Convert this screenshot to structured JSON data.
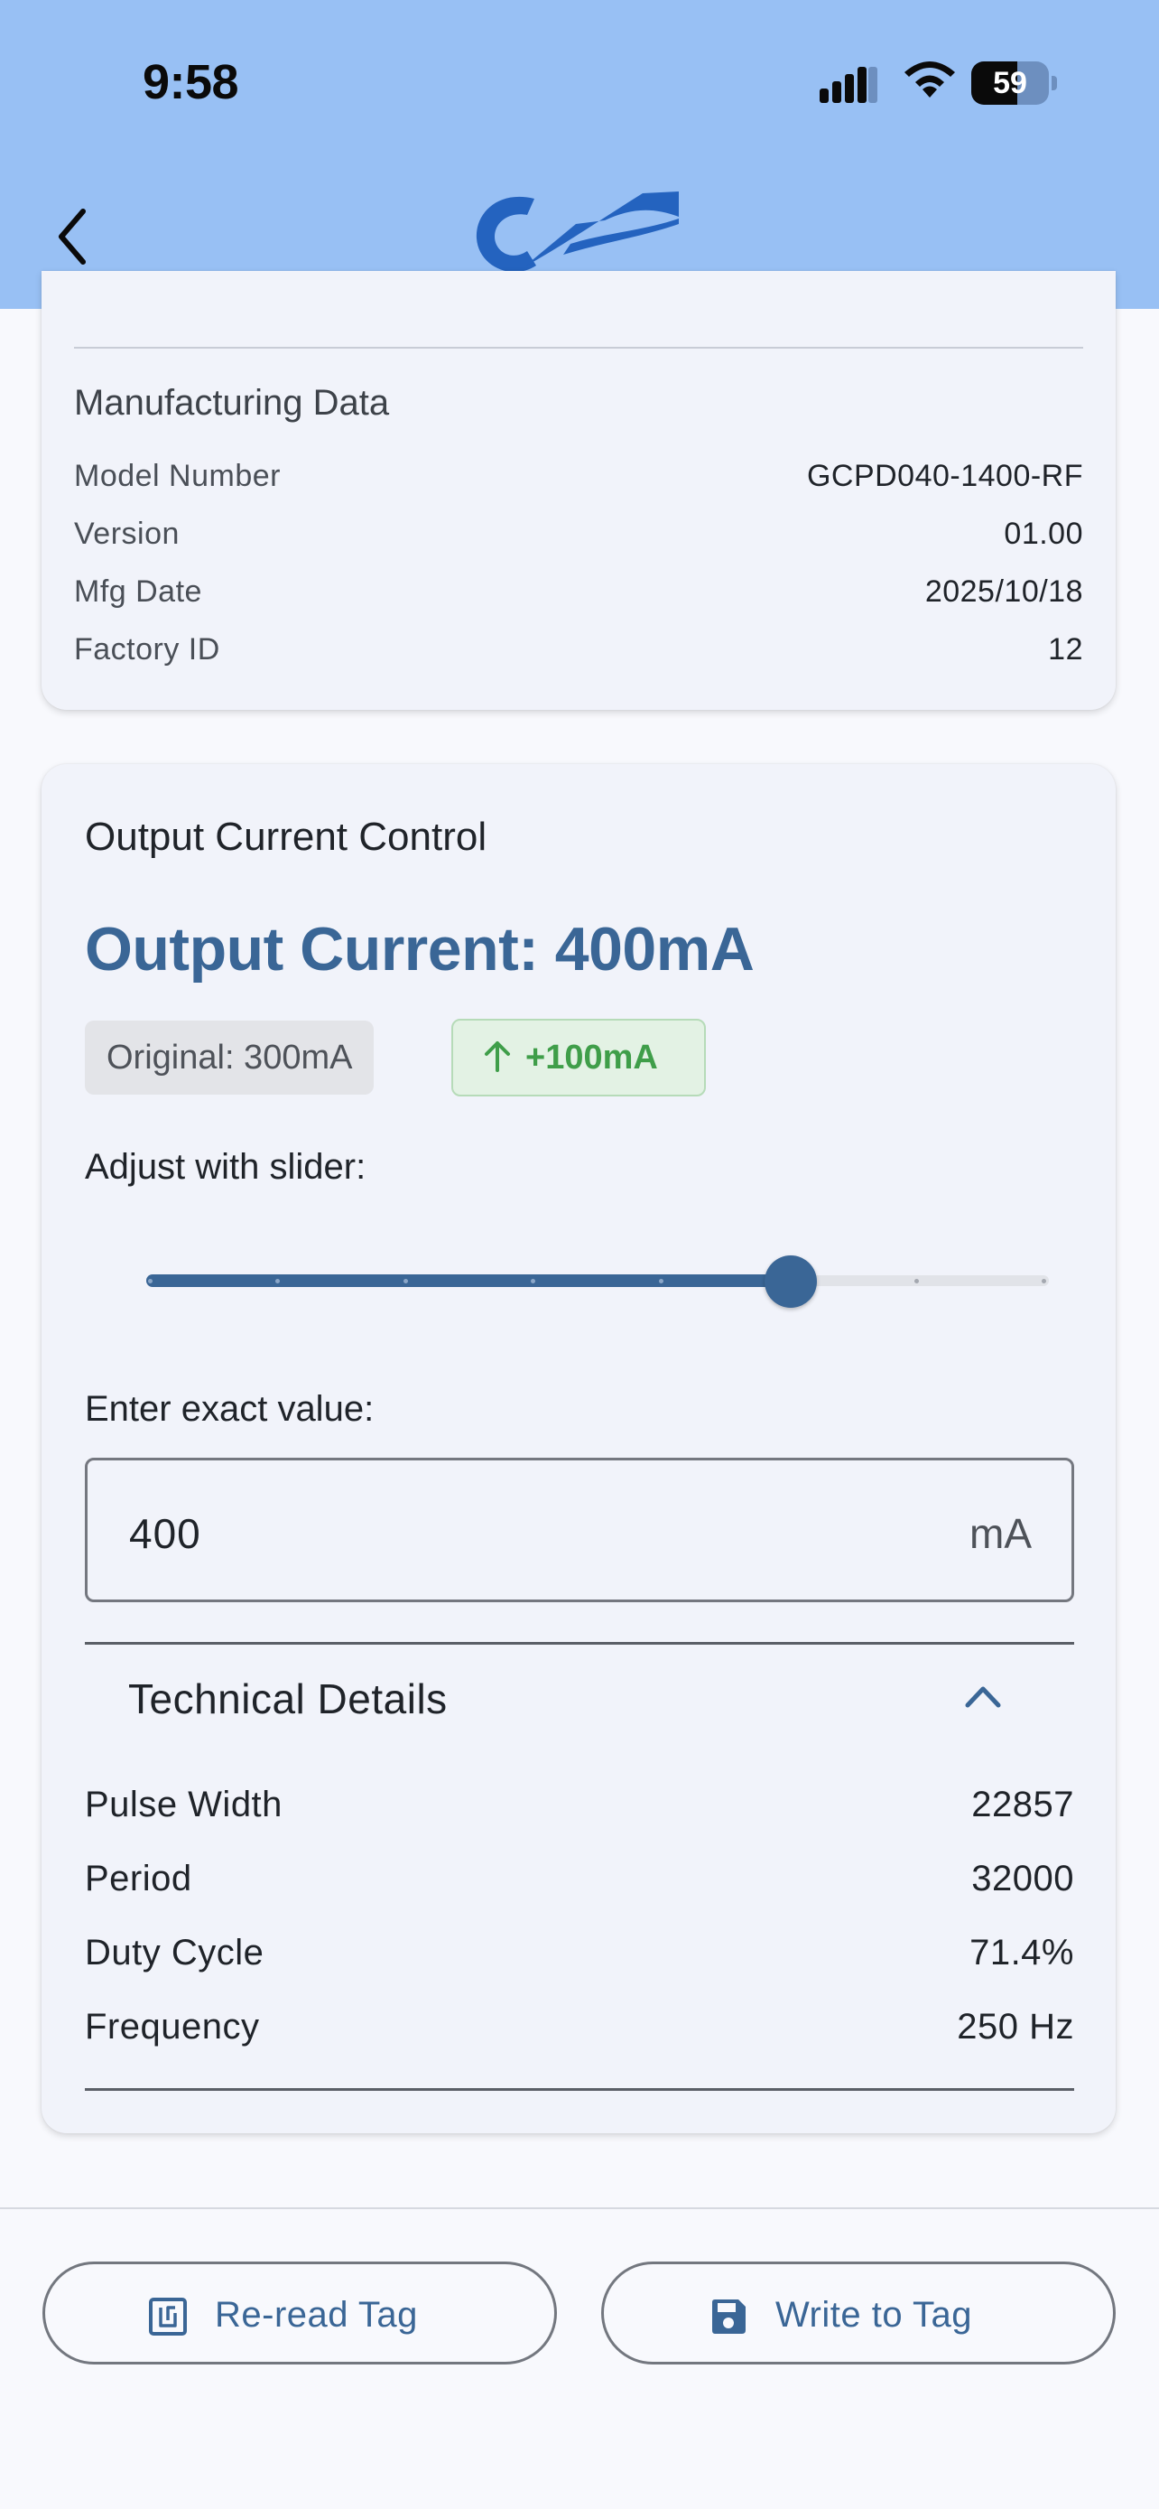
{
  "status_bar": {
    "time": "9:58",
    "battery": "59",
    "battery_level_percent": 59,
    "icons": [
      "signal-icon",
      "wifi-icon",
      "battery-icon"
    ]
  },
  "header": {
    "back_icon": "chevron-left-icon",
    "logo_icon": "brand-logo",
    "background": "#98c0f4"
  },
  "manufacturing": {
    "title": "Manufacturing Data",
    "rows": [
      {
        "label": "Model Number",
        "value": "GCPD040-1400-RF"
      },
      {
        "label": "Version",
        "value": "01.00"
      },
      {
        "label": "Mfg Date",
        "value": "2025/10/18"
      },
      {
        "label": "Factory ID",
        "value": "12"
      }
    ]
  },
  "control": {
    "title": "Output Current Control",
    "headline": "Output Current: 400mA",
    "original_chip": "Original: 300mA",
    "diff_chip": "+100mA",
    "slider_label": "Adjust with slider:",
    "slider": {
      "value_fraction": 0.7143,
      "tick_count": 8
    },
    "input_label": "Enter exact value:",
    "input_value": "400",
    "input_unit": "mA",
    "accent_color": "#3a6696",
    "increase_color": "#3f9e49"
  },
  "technical": {
    "title": "Technical Details",
    "expanded": true,
    "rows": [
      {
        "label": "Pulse Width",
        "value": "22857"
      },
      {
        "label": "Period",
        "value": "32000"
      },
      {
        "label": "Duty Cycle",
        "value": "71.4%"
      },
      {
        "label": "Frequency",
        "value": "250 Hz"
      }
    ]
  },
  "actions": {
    "reread_label": "Re-read Tag",
    "reread_icon": "nfc-icon",
    "write_label": "Write to Tag",
    "write_icon": "save-icon"
  }
}
